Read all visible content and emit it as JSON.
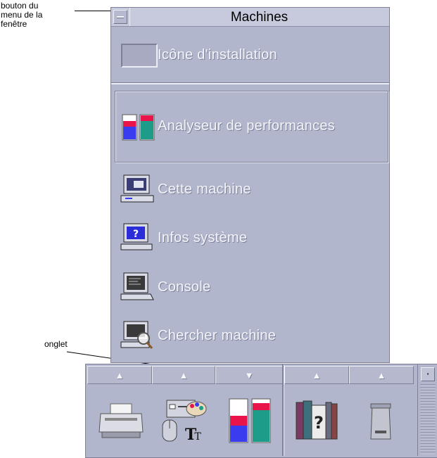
{
  "callouts": {
    "window_menu_button": [
      "bouton du",
      "menu de la",
      "fenêtre"
    ],
    "tab": "onglet"
  },
  "window": {
    "title": "Machines",
    "items": [
      {
        "label": "Icône d'installation",
        "icon": "install-drop-icon"
      },
      {
        "label": "Analyseur de performances",
        "icon": "performance-meter-icon",
        "selected": true
      },
      {
        "label": "Cette machine",
        "icon": "workstation-icon"
      },
      {
        "label": "Infos système",
        "icon": "system-info-icon"
      },
      {
        "label": "Console",
        "icon": "console-terminal-icon"
      },
      {
        "label": "Chercher machine",
        "icon": "find-host-icon"
      }
    ]
  },
  "front_panel": {
    "arrows": [
      "▲",
      "▲",
      "▼",
      "▲",
      "▲"
    ],
    "controls": [
      "printer-icon",
      "style-manager-icon",
      "performance-meter-icon",
      "help-manager-icon",
      "trash-can-icon"
    ]
  },
  "colors": {
    "panel": "#b2b6cc",
    "bar_red": "#e8144a",
    "bar_blue": "#3a3cf0",
    "bar_teal": "#1e9c8a"
  }
}
